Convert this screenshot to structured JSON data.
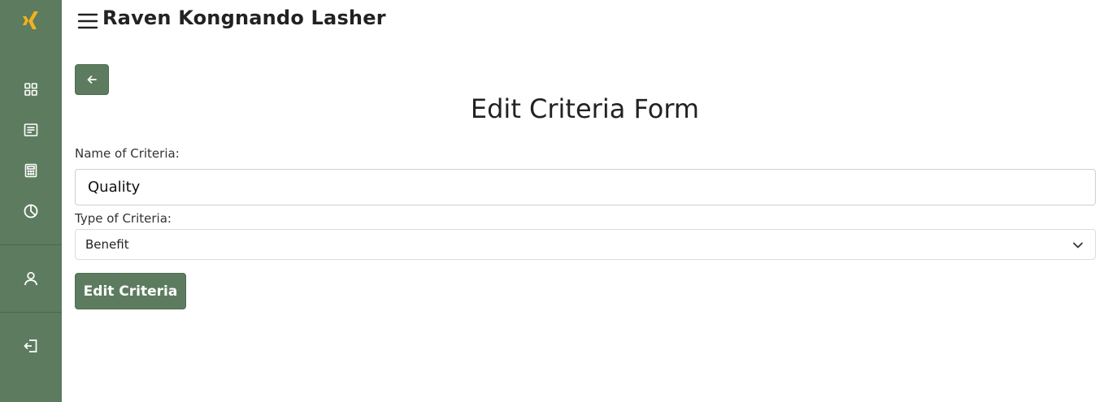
{
  "colors": {
    "brand": "#5d7c5f",
    "logo": "#f2b21c",
    "sidebar_icon": "#ffffff"
  },
  "sidebar": {
    "logo_icon": "xing-logo-icon",
    "items": [
      {
        "icon": "dashboard-grid-icon"
      },
      {
        "icon": "list-document-icon"
      },
      {
        "icon": "calculator-icon"
      },
      {
        "icon": "pie-chart-icon"
      },
      {
        "icon": "user-icon"
      },
      {
        "icon": "logout-icon"
      }
    ]
  },
  "header": {
    "menu_icon": "hamburger-menu-icon",
    "title": "Raven Kongnando Lasher"
  },
  "back_button": {
    "icon": "arrow-left-icon"
  },
  "form": {
    "title": "Edit Criteria Form",
    "name_label": "Name of Criteria:",
    "name_value": "Quality",
    "type_label": "Type of Criteria:",
    "type_value": "Benefit",
    "submit_label": "Edit Criteria"
  }
}
